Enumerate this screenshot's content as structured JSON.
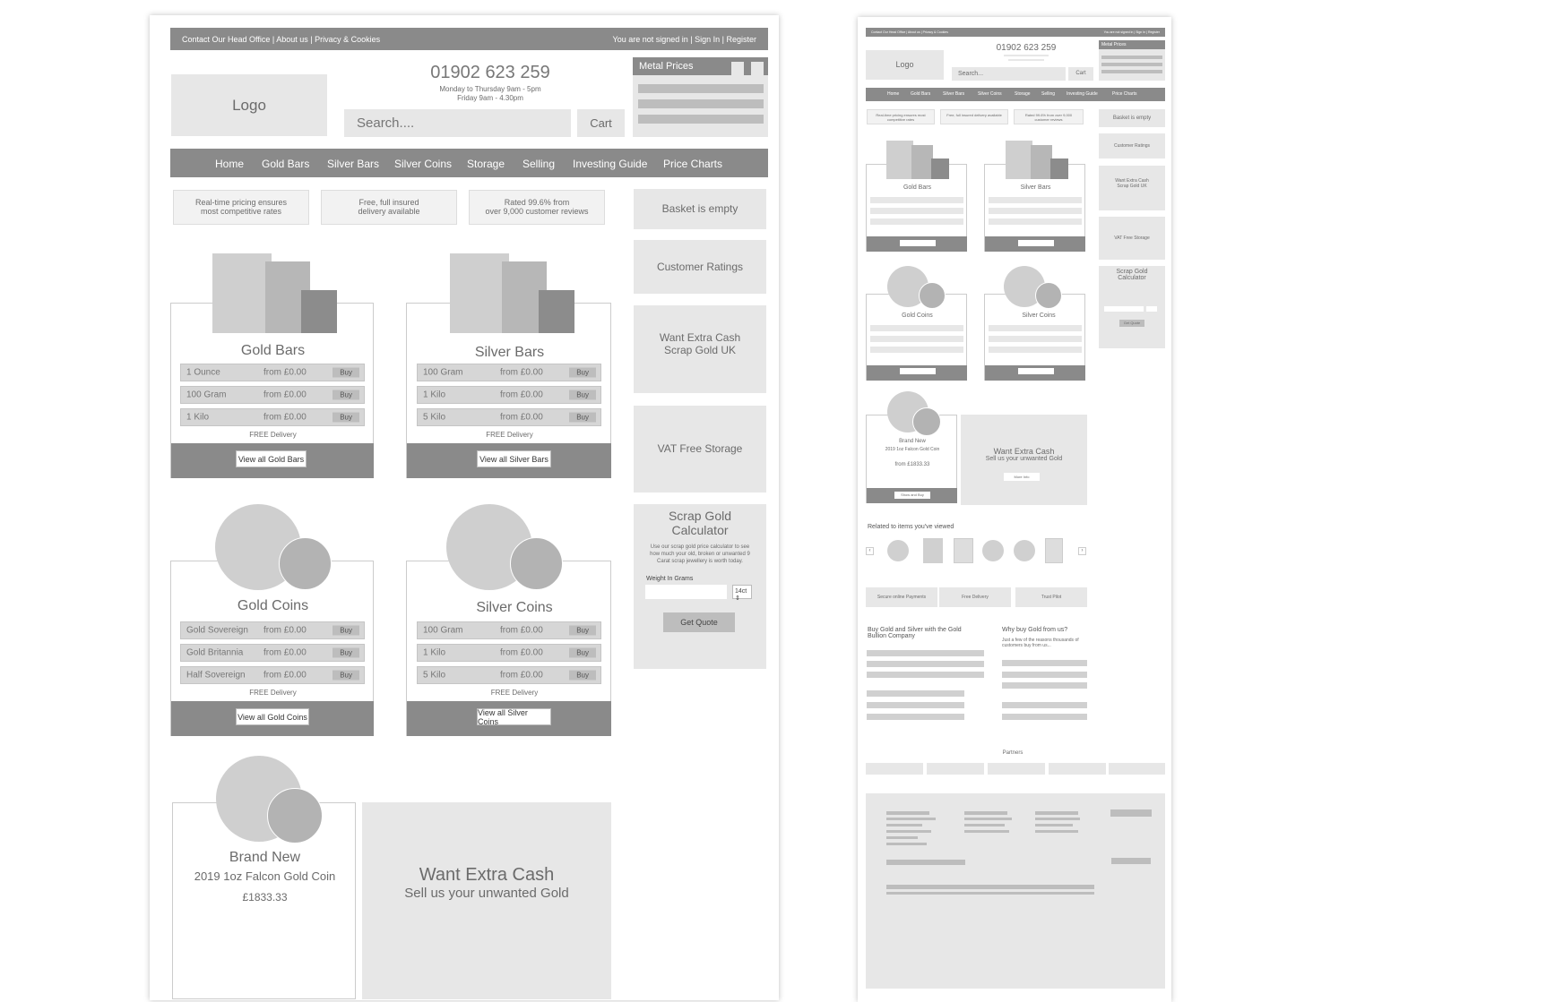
{
  "topbar": {
    "links": [
      "Contact Our Head Office",
      "About us",
      "Privacy & Cookies"
    ],
    "right": [
      "You are not signed in",
      "Sign In",
      "Register"
    ]
  },
  "header": {
    "logo": "Logo",
    "phone": "01902 623 259",
    "hours_1": "Monday to Thursday 9am - 5pm",
    "hours_2": "Friday 9am - 4.30pm",
    "search_placeholder": "Search....",
    "cart": "Cart",
    "metal_prices": "Metal Prices"
  },
  "nav": [
    "Home",
    "Gold Bars",
    "Silver Bars",
    "Silver Coins",
    "Storage",
    "Selling",
    "Investing Guide",
    "Price Charts"
  ],
  "usps": [
    {
      "l1": "Real-time pricing ensures",
      "l2": "most competitive rates"
    },
    {
      "l1": "Free, full insured",
      "l2": "delivery available"
    },
    {
      "l1": "Rated 99.6% from",
      "l2": "over 9,000 customer reviews"
    }
  ],
  "products": [
    {
      "title": "Gold Bars",
      "rows": [
        [
          "1 Ounce",
          "from £0.00"
        ],
        [
          "100 Gram",
          "from £0.00"
        ],
        [
          "1 Kilo",
          "from £0.00"
        ]
      ],
      "delivery": "FREE Delivery",
      "cta": "View all Gold Bars"
    },
    {
      "title": "Silver Bars",
      "rows": [
        [
          "100 Gram",
          "from £0.00"
        ],
        [
          "1 Kilo",
          "from £0.00"
        ],
        [
          "5 Kilo",
          "from £0.00"
        ]
      ],
      "delivery": "FREE Delivery",
      "cta": "View all Silver Bars"
    },
    {
      "title": "Gold Coins",
      "rows": [
        [
          "Gold Sovereign",
          "from £0.00"
        ],
        [
          "Gold Britannia",
          "from £0.00"
        ],
        [
          "Half Sovereign",
          "from £0.00"
        ]
      ],
      "delivery": "FREE Delivery",
      "cta": "View all Gold Coins"
    },
    {
      "title": "Silver Coins",
      "rows": [
        [
          "100 Gram",
          "from £0.00"
        ],
        [
          "1 Kilo",
          "from £0.00"
        ],
        [
          "5 Kilo",
          "from £0.00"
        ]
      ],
      "delivery": "FREE Delivery",
      "cta": "View all Silver Coins"
    }
  ],
  "buy": "Buy",
  "sidebar": {
    "basket": "Basket is empty",
    "ratings": "Customer Ratings",
    "extra_cash_1": "Want Extra Cash",
    "extra_cash_2": "Scrap Gold UK",
    "vat": "VAT Free Storage",
    "calc_title_1": "Scrap Gold",
    "calc_title_2": "Calculator",
    "calc_desc_1": "Use our scrap gold price calculator to see",
    "calc_desc_2": "how much your old, broken or unwanted 9",
    "calc_desc_3": "Carat scrap jewellery is worth today.",
    "weight_label": "Weight In Grams",
    "carat": "14ct",
    "quote": "Get Quote"
  },
  "feature": {
    "l1": "Brand New",
    "l2": "2019 1oz Falcon Gold Coin",
    "price": "£1833.33",
    "cash_title": "Want Extra Cash",
    "cash_sub": "Sell us your unwanted Gold"
  },
  "mini": {
    "topbar_left": "Contact Our Head Office | About us | Privacy & Cookies",
    "topbar_right": "You are not signed in | Sign In | Register",
    "phone": "01902 623 259",
    "logo": "Logo",
    "search": "Search...",
    "cart": "Cart",
    "metal": "Metal Prices",
    "usps": [
      "Real-time pricing ensures most competitive rates",
      "Free, full insured delivery available",
      "Rated 99.6% from over 9,000 customer reviews"
    ],
    "side": [
      "Basket is empty",
      "Customer Ratings",
      "Want Extra Cash Scrap Gold UK",
      "VAT Free Storage",
      "Scrap Gold Calculator"
    ],
    "feature_l1": "Brand New",
    "feature_l2": "2019 1oz Falcon Gold Coin",
    "feature_price": "from £1833.33",
    "feature_btn": "Show and Buy",
    "cash_title": "Want Extra Cash",
    "cash_sub": "Sell us your unwanted Gold",
    "cash_btn": "More Info",
    "related": "Related to items you've viewed",
    "trust": [
      "Secure online Payments",
      "Free Delivery",
      "Trust Pilot"
    ],
    "col1": "Buy Gold and Silver with the Gold Bullion Company",
    "col2": "Why buy Gold from us?",
    "col2_sub": "Just a few of the reasons thousands of customers buy from us...",
    "partners": "Partners",
    "quote": "Get Quote"
  }
}
